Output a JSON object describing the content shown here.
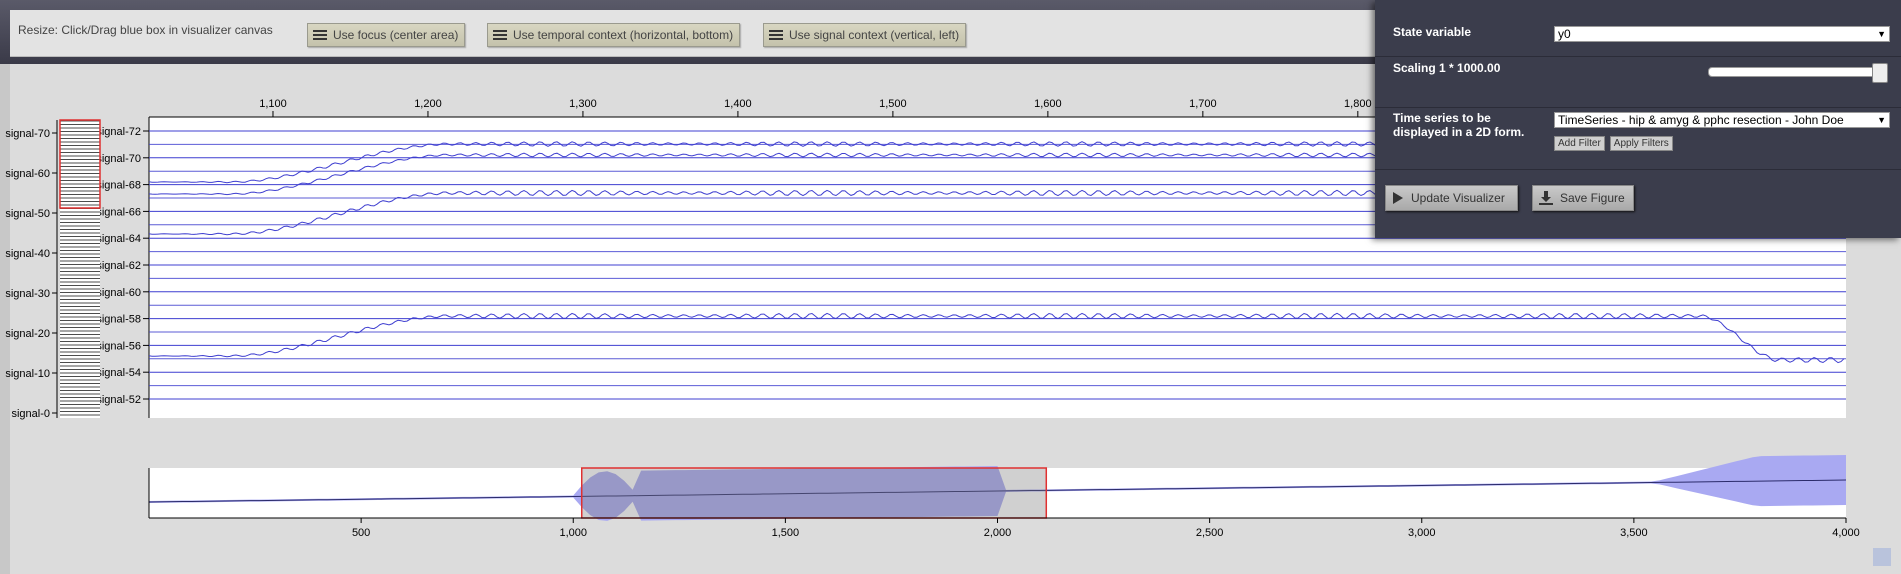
{
  "toolbar": {
    "hint": "Resize: Click/Drag blue box in visualizer canvas",
    "buttons": [
      {
        "label": "Use focus (center area)"
      },
      {
        "label": "Use temporal context (horizontal, bottom)"
      },
      {
        "label": "Use signal context (vertical, left)"
      }
    ]
  },
  "panel": {
    "state_variable_label": "State variable",
    "state_variable_value": "y0",
    "scaling_label": "Scaling 1 * 1000.00",
    "scaling_fraction": 1.0,
    "timeseries_label": "Time series to be displayed in a 2D form.",
    "timeseries_value": "TimeSeries - hip & amyg & pphc resection - John Doe",
    "add_filter": "Add Filter",
    "apply_filters": "Apply Filters",
    "update_visualizer": "Update Visualizer",
    "save_figure": "Save Figure"
  },
  "chart_data": [
    {
      "type": "line",
      "name": "focus",
      "x_ticks": [
        "1,100",
        "1,200",
        "1,300",
        "1,400",
        "1,500",
        "1,600",
        "1,700",
        "1,800"
      ],
      "x_tick_values": [
        1100,
        1200,
        1300,
        1400,
        1500,
        1600,
        1700,
        1800
      ],
      "xlim": [
        1020,
        2115
      ],
      "channel_labels": [
        "signal-72",
        "signal-70",
        "signal-68",
        "signal-66",
        "signal-64",
        "signal-62",
        "signal-60",
        "signal-58",
        "signal-56",
        "signal-54",
        "signal-52"
      ],
      "context_labels": [
        "signal-70",
        "signal-60",
        "signal-50",
        "signal-40",
        "signal-30",
        "signal-20",
        "signal-10",
        "signal-0"
      ]
    },
    {
      "type": "line",
      "name": "context",
      "x_ticks": [
        "500",
        "1,000",
        "1,500",
        "2,000",
        "2,500",
        "3,000",
        "3,500",
        "4,000"
      ],
      "x_tick_values": [
        500,
        1000,
        1500,
        2000,
        2500,
        3000,
        3500,
        4000
      ],
      "xlim": [
        0,
        4000
      ],
      "selection": [
        1020,
        2115
      ]
    }
  ],
  "colors": {
    "line": "#3f3fd0",
    "selection": "#e03030",
    "envelope": "#a9a9f2",
    "panel_bg": "#3b3d4c"
  }
}
